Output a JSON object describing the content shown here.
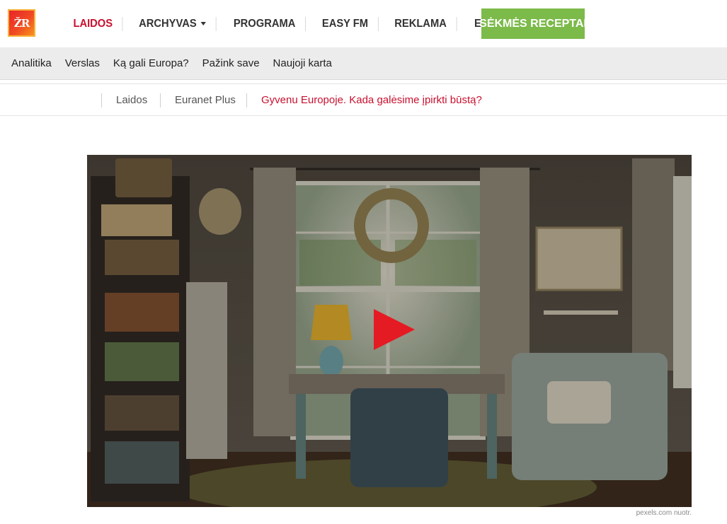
{
  "logo": {
    "text": "ŽR"
  },
  "nav": {
    "items": [
      {
        "label": "LAIDOS"
      },
      {
        "label": "ARCHYVAS"
      },
      {
        "label": "PROGRAMA"
      },
      {
        "label": "EASY FM"
      },
      {
        "label": "REKLAMA"
      },
      {
        "label": "EURANET PLUS"
      }
    ],
    "cta": "SĖKMĖS RECEPTAI",
    "active_color": "#c8102e",
    "cta_color": "#7cba4a"
  },
  "subnav": {
    "items": [
      "Analitika",
      "Verslas",
      "Ką gali Europa?",
      "Pažink save",
      "Naujoji karta"
    ]
  },
  "breadcrumb": {
    "items": [
      "Laidos",
      "Euranet Plus",
      "Gyvenu Europoje. Kada galėsime įpirkti būstą?"
    ]
  },
  "video": {
    "play_icon": "play-icon",
    "play_color": "#e41b23",
    "caption": "pexels.com nuotr."
  }
}
